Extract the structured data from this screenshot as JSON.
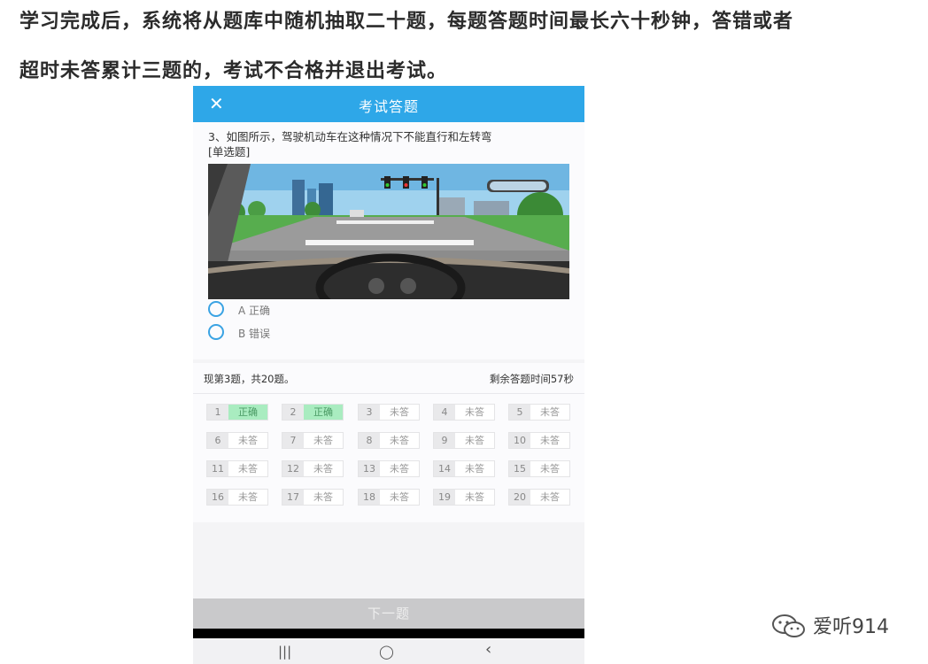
{
  "intro": {
    "line1": "学习完成后，系统将从题库中随机抽取二十题，每题答题时间最长六十秒钟，答错或者",
    "line2": "超时未答累计三题的，考试不合格并退出考试。"
  },
  "header": {
    "close_icon": "close-icon",
    "title": "考试答题"
  },
  "question": {
    "text": "3、如图所示，驾驶机动车在这种情况下不能直行和左转弯",
    "type": "[单选题]",
    "options": [
      {
        "label": "A 正确"
      },
      {
        "label": "B 错误"
      }
    ]
  },
  "status": {
    "progress": "现第3题，共20题。",
    "timer": "剩余答题时间57秒"
  },
  "answer_grid": [
    {
      "num": "1",
      "state": "正确",
      "correct": true
    },
    {
      "num": "2",
      "state": "正确",
      "correct": true
    },
    {
      "num": "3",
      "state": "未答",
      "correct": false
    },
    {
      "num": "4",
      "state": "未答",
      "correct": false
    },
    {
      "num": "5",
      "state": "未答",
      "correct": false
    },
    {
      "num": "6",
      "state": "未答",
      "correct": false
    },
    {
      "num": "7",
      "state": "未答",
      "correct": false
    },
    {
      "num": "8",
      "state": "未答",
      "correct": false
    },
    {
      "num": "9",
      "state": "未答",
      "correct": false
    },
    {
      "num": "10",
      "state": "未答",
      "correct": false
    },
    {
      "num": "11",
      "state": "未答",
      "correct": false
    },
    {
      "num": "12",
      "state": "未答",
      "correct": false
    },
    {
      "num": "13",
      "state": "未答",
      "correct": false
    },
    {
      "num": "14",
      "state": "未答",
      "correct": false
    },
    {
      "num": "15",
      "state": "未答",
      "correct": false
    },
    {
      "num": "16",
      "state": "未答",
      "correct": false
    },
    {
      "num": "17",
      "state": "未答",
      "correct": false
    },
    {
      "num": "18",
      "state": "未答",
      "correct": false
    },
    {
      "num": "19",
      "state": "未答",
      "correct": false
    },
    {
      "num": "20",
      "state": "未答",
      "correct": false
    }
  ],
  "next_button": "下一题",
  "android_nav": {
    "recent": "|||",
    "home": "◯",
    "back": "‹"
  },
  "watermark": {
    "icon": "wechat-icon",
    "text": "爱听914"
  },
  "colors": {
    "header": "#2ea7e8",
    "radio": "#3aa3e3",
    "correct_bg": "#a9ecc0",
    "next_button": "#c9c9cb"
  }
}
